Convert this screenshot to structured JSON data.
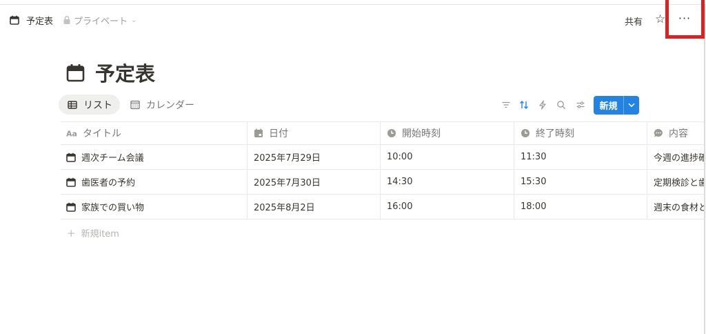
{
  "breadcrumb": {
    "title": "予定表",
    "privacy": "プライベート"
  },
  "topbar": {
    "share_label": "共有",
    "star_icon": "star-icon",
    "more_label": "···"
  },
  "page": {
    "title": "予定表",
    "icon": "calendar-icon"
  },
  "views": [
    {
      "label": "リスト",
      "icon": "table-icon",
      "active": true
    },
    {
      "label": "カレンダー",
      "icon": "calendar-grid-icon",
      "active": false
    }
  ],
  "toolbar": {
    "icons": [
      "filter-icon",
      "sort-icon",
      "automation-icon",
      "search-icon",
      "settings-icon"
    ],
    "new_label": "新規",
    "accent": "#2383e2"
  },
  "table": {
    "columns": [
      {
        "label": "タイトル",
        "icon": "text-type-icon"
      },
      {
        "label": "日付",
        "icon": "date-icon"
      },
      {
        "label": "開始時刻",
        "icon": "clock-icon"
      },
      {
        "label": "終了時刻",
        "icon": "clock-icon"
      },
      {
        "label": "内容",
        "icon": "comment-icon"
      }
    ],
    "rows": [
      {
        "title": "週次チーム会議",
        "date": "2025年7月29日",
        "start": "10:00",
        "end": "11:30",
        "content": "今週の進捗確"
      },
      {
        "title": "歯医者の予約",
        "date": "2025年7月30日",
        "start": "14:30",
        "end": "15:30",
        "content": "定期検診と歯"
      },
      {
        "title": "家族での買い物",
        "date": "2025年8月2日",
        "start": "16:00",
        "end": "18:00",
        "content": "週末の食材と"
      }
    ],
    "add_row_label": "新規item"
  }
}
